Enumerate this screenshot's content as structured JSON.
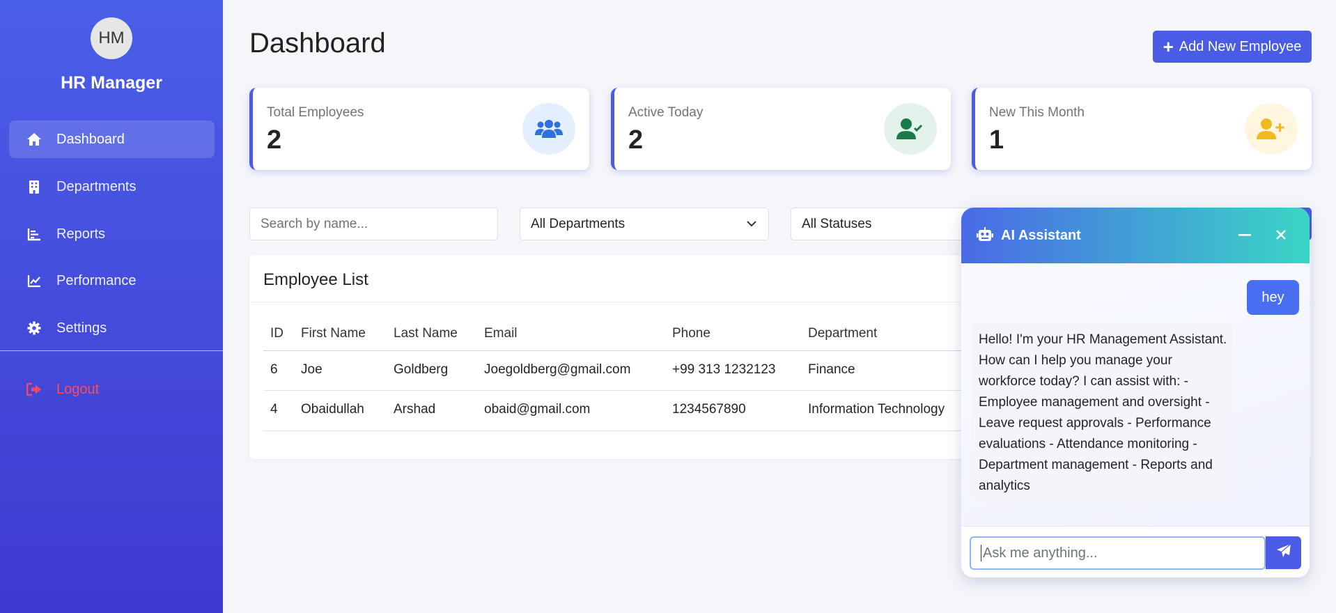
{
  "sidebar": {
    "avatar_initials": "HM",
    "brand": "HR Manager",
    "items": [
      {
        "label": "Dashboard",
        "icon": "home-icon"
      },
      {
        "label": "Departments",
        "icon": "building-icon"
      },
      {
        "label": "Reports",
        "icon": "reports-icon"
      },
      {
        "label": "Performance",
        "icon": "chart-line-icon"
      },
      {
        "label": "Settings",
        "icon": "gear-icon"
      }
    ],
    "logout_label": "Logout"
  },
  "header": {
    "title": "Dashboard",
    "add_button_label": "Add New Employee"
  },
  "stats": [
    {
      "label": "Total Employees",
      "value": "2",
      "icon": "users-icon",
      "icon_color": "#2f6fe4",
      "icon_bg": "#e3efff"
    },
    {
      "label": "Active Today",
      "value": "2",
      "icon": "user-check-icon",
      "icon_color": "#1b7a4a",
      "icon_bg": "#e3f2ea"
    },
    {
      "label": "New This Month",
      "value": "1",
      "icon": "user-plus-icon",
      "icon_color": "#f2b81f",
      "icon_bg": "#fff6df"
    }
  ],
  "filters": {
    "search_placeholder": "Search by name...",
    "department_selected": "All Departments",
    "status_selected": "All Statuses"
  },
  "table": {
    "title": "Employee List",
    "columns": [
      "ID",
      "First Name",
      "Last Name",
      "Email",
      "Phone",
      "Department"
    ],
    "rows": [
      [
        "6",
        "Joe",
        "Goldberg",
        "Joegoldberg@gmail.com",
        "+99 313 1232123",
        "Finance"
      ],
      [
        "4",
        "Obaidullah",
        "Arshad",
        "obaid@gmail.com",
        "1234567890",
        "Information Technology"
      ]
    ]
  },
  "chat": {
    "title": "AI Assistant",
    "user_message": "hey",
    "bot_message": "Hello! I'm your HR Management Assistant. How can I help you manage your workforce today? I can assist with: - Employee management and oversight - Leave request approvals - Performance evaluations - Attendance monitoring - Department management - Reports and analytics",
    "input_placeholder": "Ask me anything..."
  },
  "colors": {
    "accent": "#4a5be6",
    "logout": "#ff4a5a"
  }
}
